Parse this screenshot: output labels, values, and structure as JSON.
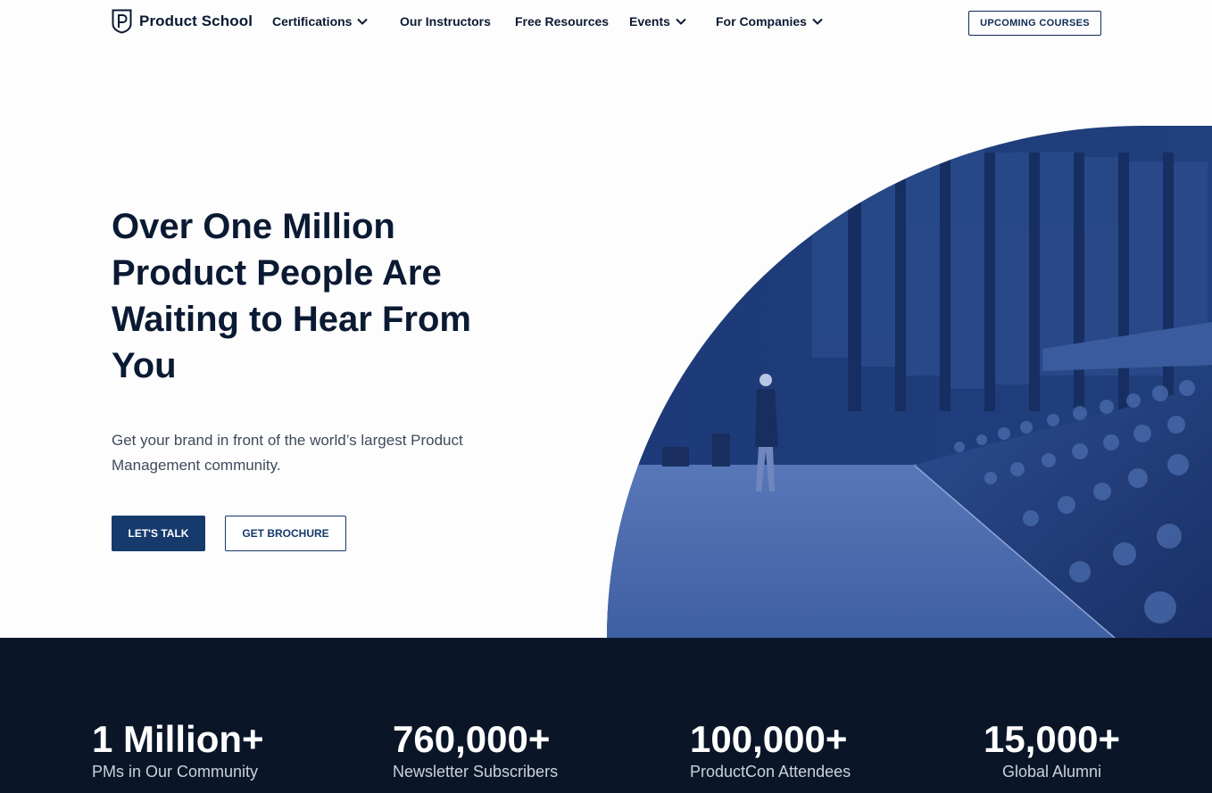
{
  "brand": {
    "name": "Product School"
  },
  "nav": {
    "items": [
      {
        "label": "Certifications",
        "dropdown": true
      },
      {
        "label": "Our Instructors",
        "dropdown": false
      },
      {
        "label": "Free Resources",
        "dropdown": false
      },
      {
        "label": "Events",
        "dropdown": true
      },
      {
        "label": "For Companies",
        "dropdown": true
      }
    ],
    "cta": "UPCOMING COURSES"
  },
  "hero": {
    "headline": "Over One Million Product People Are Waiting to Hear From You",
    "subtitle": "Get your brand in front of the world’s largest Product Management community.",
    "primary_button": "LET'S TALK",
    "secondary_button": "GET BROCHURE"
  },
  "stats": [
    {
      "value": "1 Million+",
      "label": "PMs in Our Community"
    },
    {
      "value": "760,000+",
      "label": "Newsletter Subscribers"
    },
    {
      "value": "100,000+",
      "label": "ProductCon Attendees"
    },
    {
      "value": "15,000+",
      "label": "Global Alumni"
    }
  ],
  "colors": {
    "navy": "#0b1a33",
    "primary": "#153a6b",
    "stats_bg": "#0a1628",
    "image_tint": "#2a4f8f"
  }
}
